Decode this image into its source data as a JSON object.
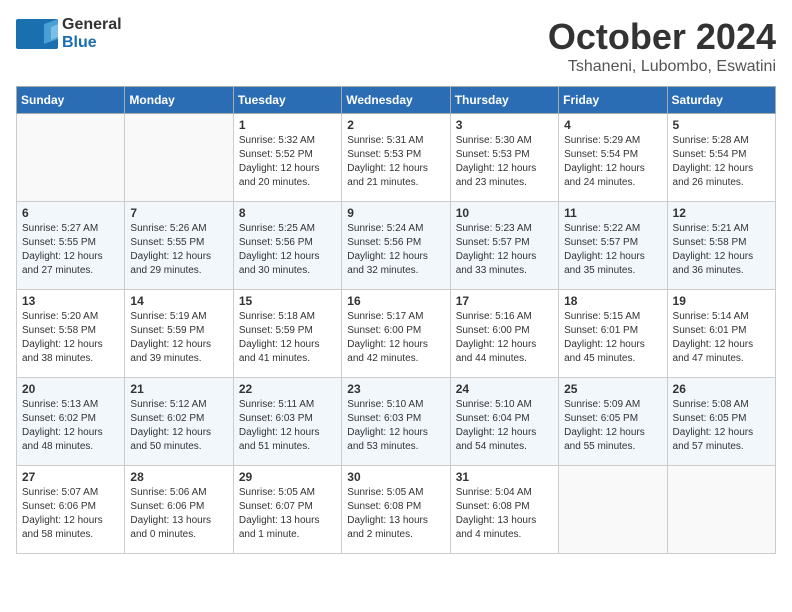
{
  "header": {
    "logo_general": "General",
    "logo_blue": "Blue",
    "month_title": "October 2024",
    "location": "Tshaneni, Lubombo, Eswatini"
  },
  "days_of_week": [
    "Sunday",
    "Monday",
    "Tuesday",
    "Wednesday",
    "Thursday",
    "Friday",
    "Saturday"
  ],
  "weeks": [
    [
      {
        "day": "",
        "info": ""
      },
      {
        "day": "",
        "info": ""
      },
      {
        "day": "1",
        "info": "Sunrise: 5:32 AM\nSunset: 5:52 PM\nDaylight: 12 hours and 20 minutes."
      },
      {
        "day": "2",
        "info": "Sunrise: 5:31 AM\nSunset: 5:53 PM\nDaylight: 12 hours and 21 minutes."
      },
      {
        "day": "3",
        "info": "Sunrise: 5:30 AM\nSunset: 5:53 PM\nDaylight: 12 hours and 23 minutes."
      },
      {
        "day": "4",
        "info": "Sunrise: 5:29 AM\nSunset: 5:54 PM\nDaylight: 12 hours and 24 minutes."
      },
      {
        "day": "5",
        "info": "Sunrise: 5:28 AM\nSunset: 5:54 PM\nDaylight: 12 hours and 26 minutes."
      }
    ],
    [
      {
        "day": "6",
        "info": "Sunrise: 5:27 AM\nSunset: 5:55 PM\nDaylight: 12 hours and 27 minutes."
      },
      {
        "day": "7",
        "info": "Sunrise: 5:26 AM\nSunset: 5:55 PM\nDaylight: 12 hours and 29 minutes."
      },
      {
        "day": "8",
        "info": "Sunrise: 5:25 AM\nSunset: 5:56 PM\nDaylight: 12 hours and 30 minutes."
      },
      {
        "day": "9",
        "info": "Sunrise: 5:24 AM\nSunset: 5:56 PM\nDaylight: 12 hours and 32 minutes."
      },
      {
        "day": "10",
        "info": "Sunrise: 5:23 AM\nSunset: 5:57 PM\nDaylight: 12 hours and 33 minutes."
      },
      {
        "day": "11",
        "info": "Sunrise: 5:22 AM\nSunset: 5:57 PM\nDaylight: 12 hours and 35 minutes."
      },
      {
        "day": "12",
        "info": "Sunrise: 5:21 AM\nSunset: 5:58 PM\nDaylight: 12 hours and 36 minutes."
      }
    ],
    [
      {
        "day": "13",
        "info": "Sunrise: 5:20 AM\nSunset: 5:58 PM\nDaylight: 12 hours and 38 minutes."
      },
      {
        "day": "14",
        "info": "Sunrise: 5:19 AM\nSunset: 5:59 PM\nDaylight: 12 hours and 39 minutes."
      },
      {
        "day": "15",
        "info": "Sunrise: 5:18 AM\nSunset: 5:59 PM\nDaylight: 12 hours and 41 minutes."
      },
      {
        "day": "16",
        "info": "Sunrise: 5:17 AM\nSunset: 6:00 PM\nDaylight: 12 hours and 42 minutes."
      },
      {
        "day": "17",
        "info": "Sunrise: 5:16 AM\nSunset: 6:00 PM\nDaylight: 12 hours and 44 minutes."
      },
      {
        "day": "18",
        "info": "Sunrise: 5:15 AM\nSunset: 6:01 PM\nDaylight: 12 hours and 45 minutes."
      },
      {
        "day": "19",
        "info": "Sunrise: 5:14 AM\nSunset: 6:01 PM\nDaylight: 12 hours and 47 minutes."
      }
    ],
    [
      {
        "day": "20",
        "info": "Sunrise: 5:13 AM\nSunset: 6:02 PM\nDaylight: 12 hours and 48 minutes."
      },
      {
        "day": "21",
        "info": "Sunrise: 5:12 AM\nSunset: 6:02 PM\nDaylight: 12 hours and 50 minutes."
      },
      {
        "day": "22",
        "info": "Sunrise: 5:11 AM\nSunset: 6:03 PM\nDaylight: 12 hours and 51 minutes."
      },
      {
        "day": "23",
        "info": "Sunrise: 5:10 AM\nSunset: 6:03 PM\nDaylight: 12 hours and 53 minutes."
      },
      {
        "day": "24",
        "info": "Sunrise: 5:10 AM\nSunset: 6:04 PM\nDaylight: 12 hours and 54 minutes."
      },
      {
        "day": "25",
        "info": "Sunrise: 5:09 AM\nSunset: 6:05 PM\nDaylight: 12 hours and 55 minutes."
      },
      {
        "day": "26",
        "info": "Sunrise: 5:08 AM\nSunset: 6:05 PM\nDaylight: 12 hours and 57 minutes."
      }
    ],
    [
      {
        "day": "27",
        "info": "Sunrise: 5:07 AM\nSunset: 6:06 PM\nDaylight: 12 hours and 58 minutes."
      },
      {
        "day": "28",
        "info": "Sunrise: 5:06 AM\nSunset: 6:06 PM\nDaylight: 13 hours and 0 minutes."
      },
      {
        "day": "29",
        "info": "Sunrise: 5:05 AM\nSunset: 6:07 PM\nDaylight: 13 hours and 1 minute."
      },
      {
        "day": "30",
        "info": "Sunrise: 5:05 AM\nSunset: 6:08 PM\nDaylight: 13 hours and 2 minutes."
      },
      {
        "day": "31",
        "info": "Sunrise: 5:04 AM\nSunset: 6:08 PM\nDaylight: 13 hours and 4 minutes."
      },
      {
        "day": "",
        "info": ""
      },
      {
        "day": "",
        "info": ""
      }
    ]
  ]
}
